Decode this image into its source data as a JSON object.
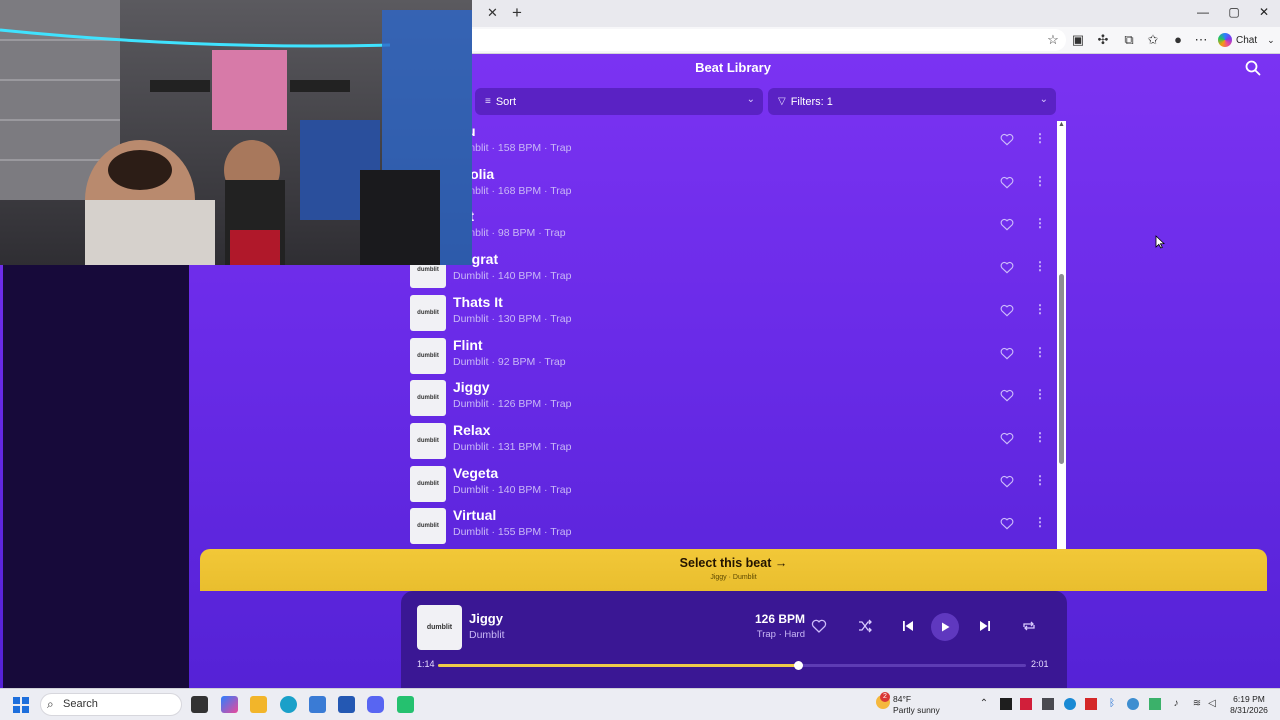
{
  "browser": {
    "chat_label": "Chat"
  },
  "header": {
    "title": "Beat Library"
  },
  "toolbar": {
    "sort_label": "Sort",
    "filters_label": "Filters: 1"
  },
  "beats": [
    {
      "title": "Blu",
      "meta": "Dumblit · 158 BPM · Trap"
    },
    {
      "title": "gnolia",
      "meta": "Dumblit · 168 BPM · Trap"
    },
    {
      "title": "p It",
      "meta": "Dumblit · 98 BPM · Trap"
    },
    {
      "title": "Rugrat",
      "meta": "Dumblit · 140 BPM · Trap"
    },
    {
      "title": "Thats It",
      "meta": "Dumblit · 130 BPM · Trap"
    },
    {
      "title": "Flint",
      "meta": "Dumblit · 92 BPM · Trap"
    },
    {
      "title": "Jiggy",
      "meta": "Dumblit · 126 BPM · Trap"
    },
    {
      "title": "Relax",
      "meta": "Dumblit · 131 BPM · Trap"
    },
    {
      "title": "Vegeta",
      "meta": "Dumblit · 140 BPM · Trap"
    },
    {
      "title": "Virtual",
      "meta": "Dumblit · 155 BPM · Trap"
    }
  ],
  "thumb_label": "dumblit",
  "select_bar": {
    "label": "Select this beat →",
    "sub": "Jiggy · Dumblit"
  },
  "player": {
    "title": "Jiggy",
    "artist": "Dumblit",
    "bpm": "126 BPM",
    "tags": "Trap · Hard",
    "elapsed": "1:14",
    "duration": "2:01",
    "progress": 0.612,
    "accent": "#efcb4a"
  },
  "taskbar": {
    "search_label": "Search",
    "weather_temp": "84°F",
    "weather_desc": "Partly sunny",
    "time": "6:19 PM",
    "date": "8/31/2026",
    "badge": "2"
  }
}
